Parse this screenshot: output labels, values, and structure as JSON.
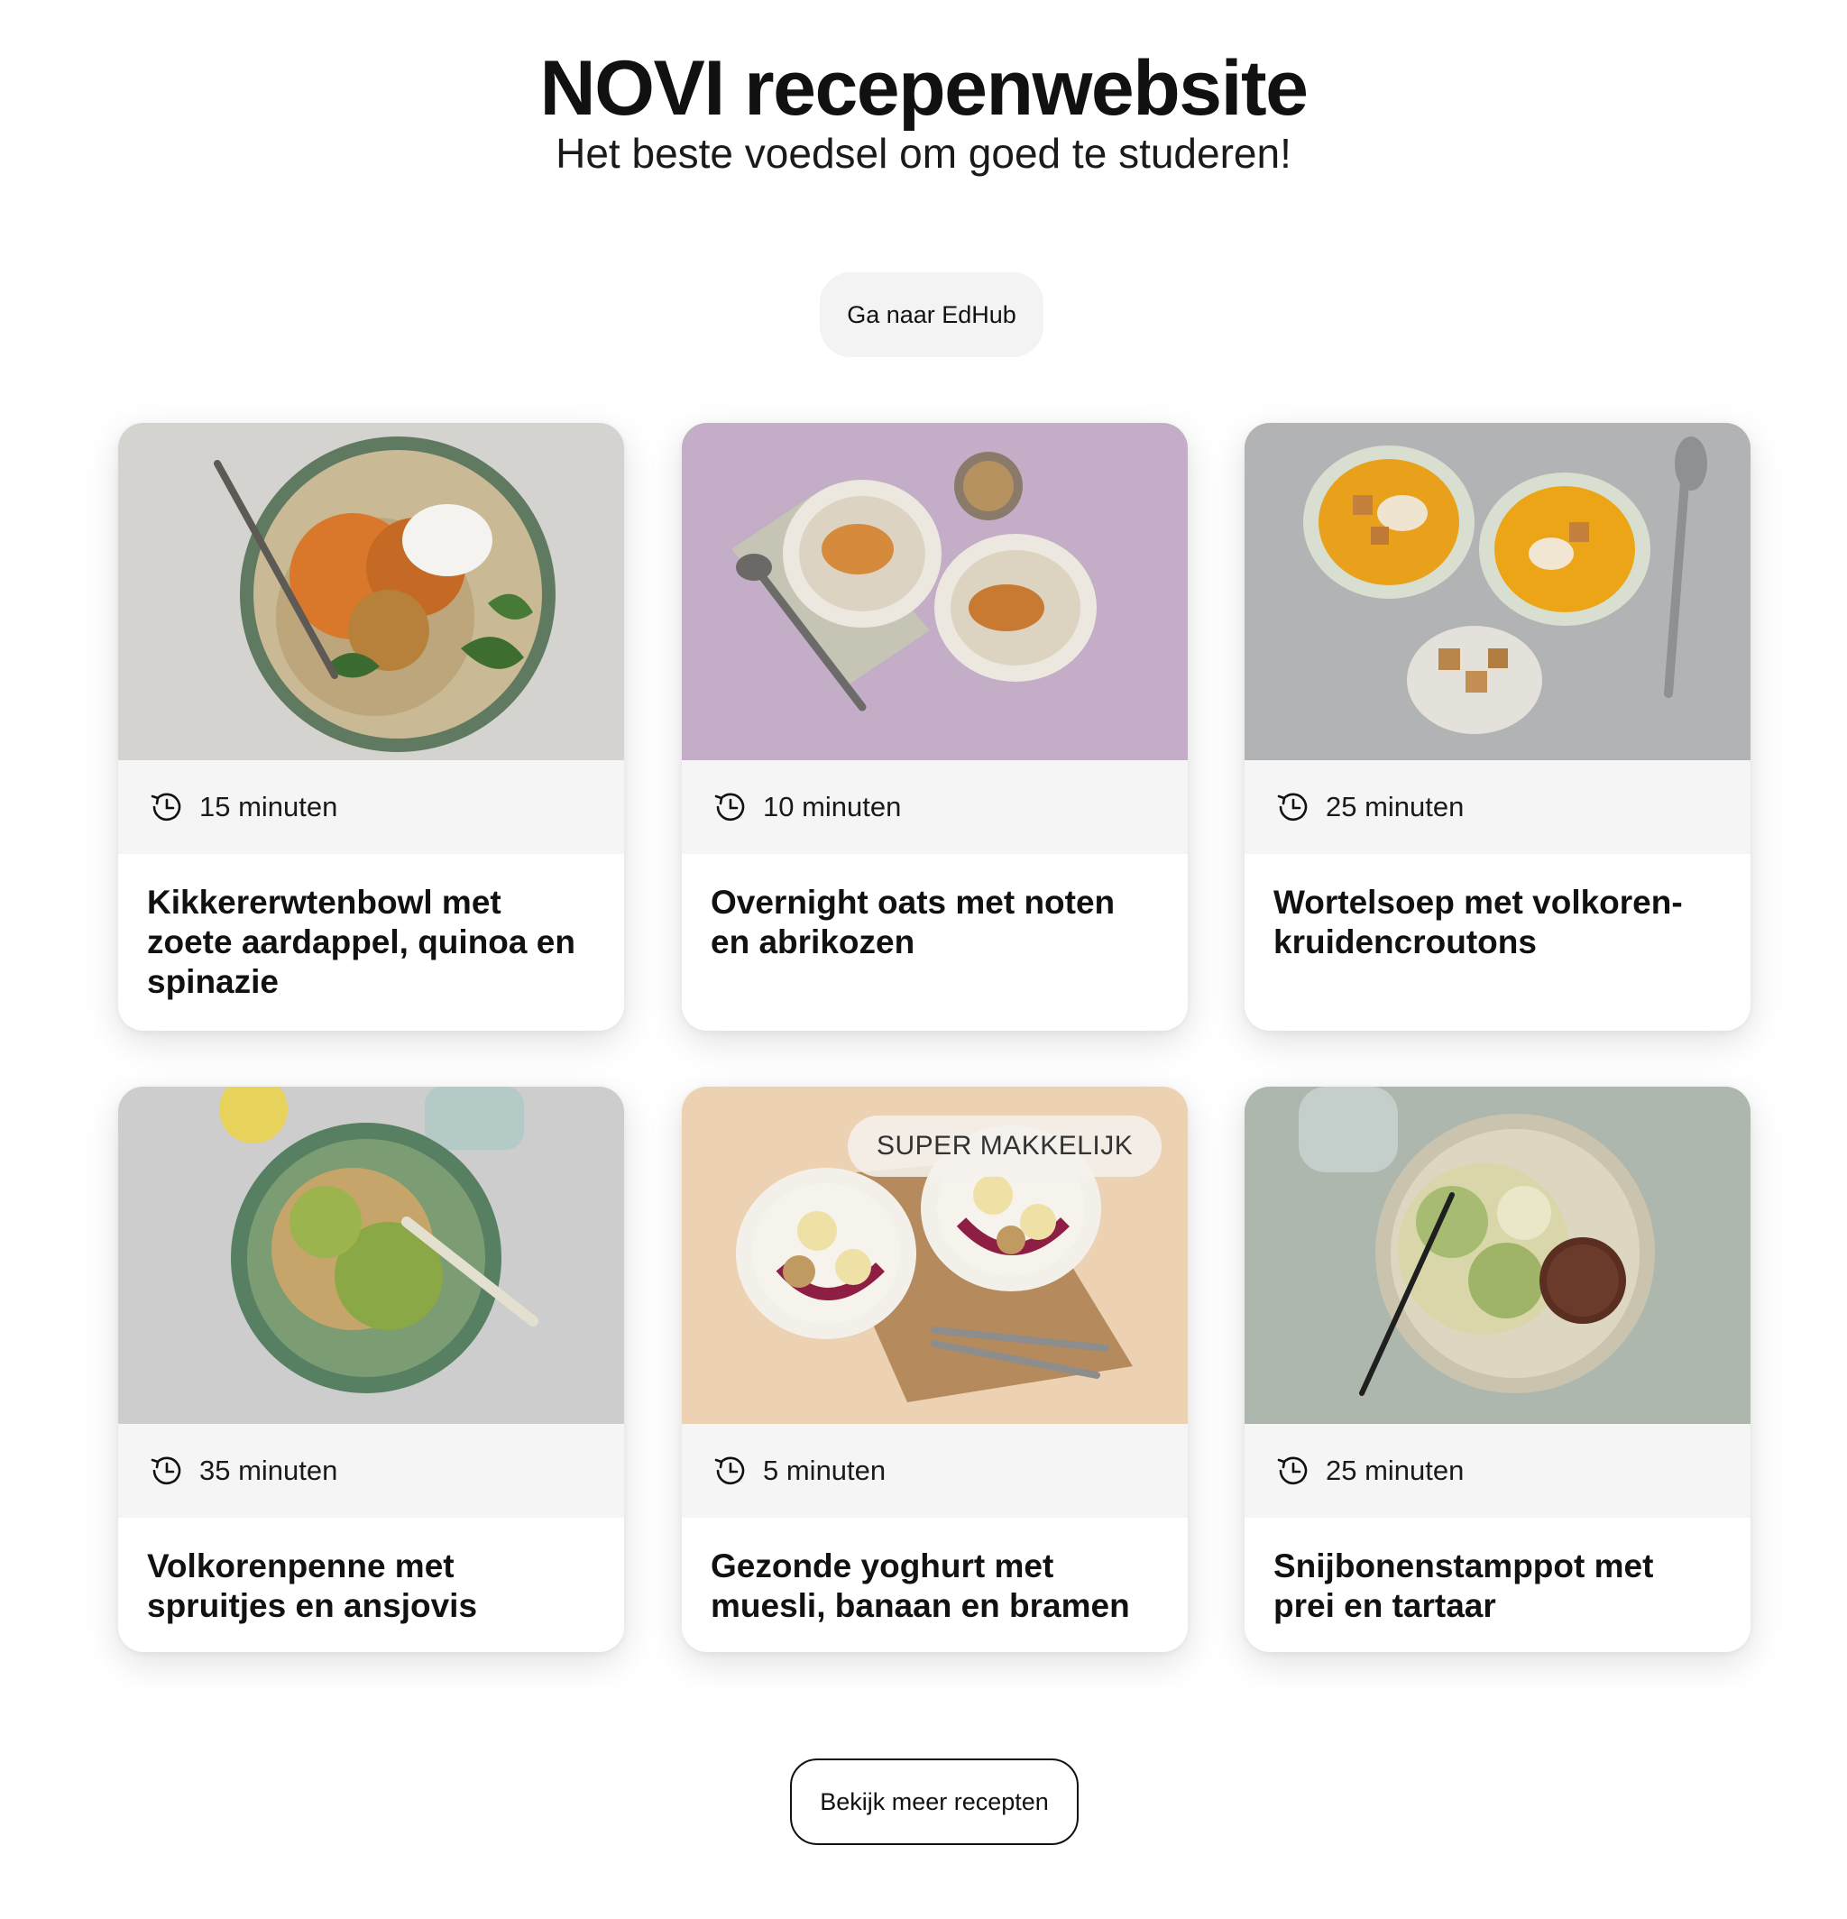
{
  "header": {
    "title": "NOVI recepenwebsite",
    "subtitle": "Het beste voedsel om goed te studeren!"
  },
  "edhub_button": {
    "label": "Ga naar EdHub"
  },
  "recipes": [
    {
      "time": "15 minuten",
      "title": "Kikkererwtenbowl met zoete aardappel, quinoa en spinazie",
      "photo_icon": "chickpea-bowl-photo"
    },
    {
      "time": "10 minuten",
      "title": "Overnight oats met noten en abrikozen",
      "photo_icon": "overnight-oats-photo"
    },
    {
      "time": "25 minuten",
      "title": "Wortelsoep met volkoren-kruidencroutons",
      "photo_icon": "carrot-soup-photo"
    },
    {
      "time": "35 minuten",
      "title": "Volkorenpenne met spruitjes en ansjovis",
      "photo_icon": "penne-photo"
    },
    {
      "time": "5 minuten",
      "title": "Gezonde yoghurt met muesli, banaan en bramen",
      "photo_icon": "yoghurt-photo",
      "badge": "SUPER MAKKELIJK"
    },
    {
      "time": "25 minuten",
      "title": "Snijbonenstamppot met prei en tartaar",
      "photo_icon": "stamppot-photo"
    }
  ],
  "more_button": {
    "label": "Bekijk meer recepten"
  },
  "colors": {
    "text": "#111111",
    "time_bar_bg": "#f5f5f5",
    "button_bg": "#f3f3f3",
    "page_bg": "#ffffff"
  }
}
